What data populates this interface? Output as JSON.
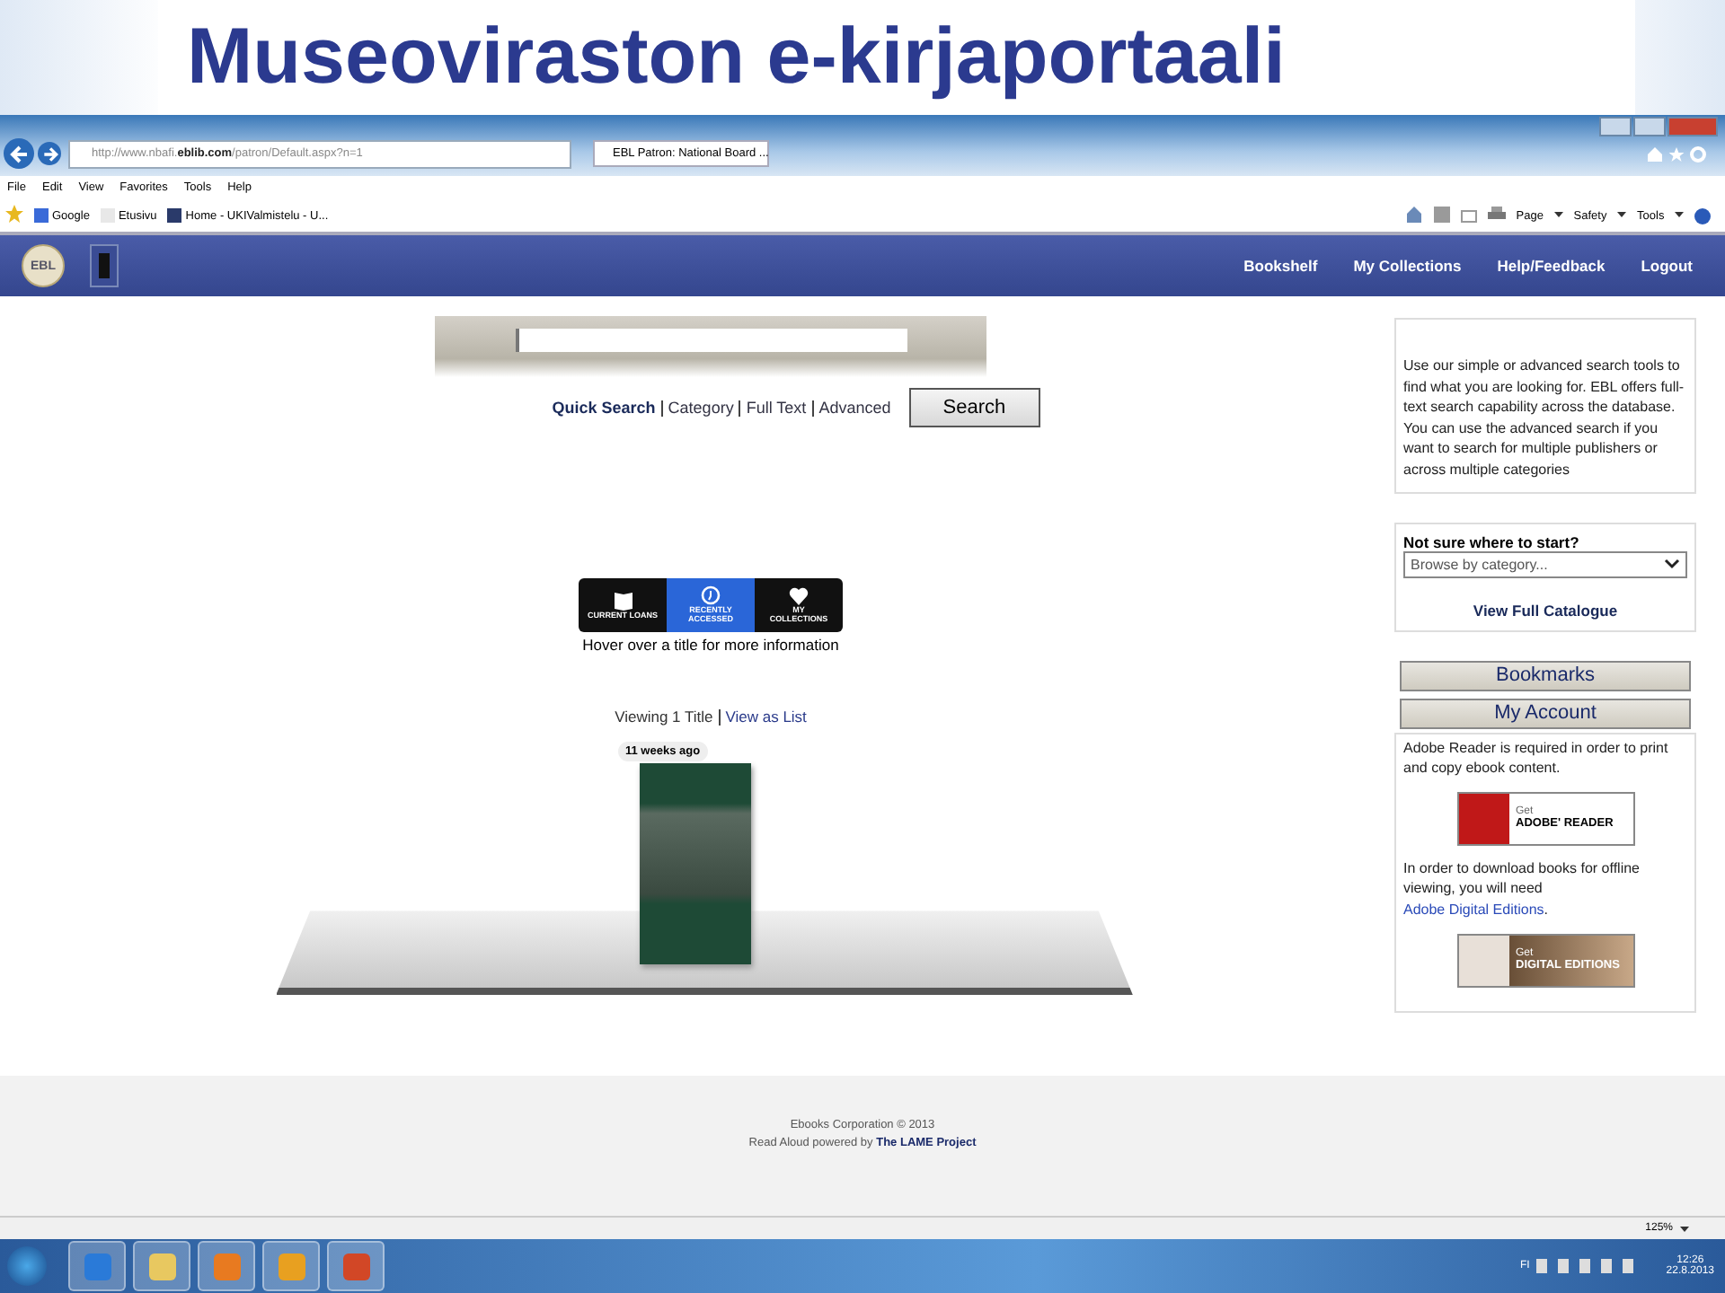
{
  "slide_title": "Museoviraston e-kirjaportaali",
  "browser": {
    "address": "http://www.nbafi.**eblib.com**/patron/Default.aspx?n=1",
    "tab_title": "EBL Patron: National Board ...",
    "menu": [
      "File",
      "Edit",
      "View",
      "Favorites",
      "Tools",
      "Help"
    ],
    "favorites": [
      {
        "kind": "google",
        "label": "Google"
      },
      {
        "kind": "page",
        "label": "Etusivu"
      },
      {
        "kind": "site",
        "label": "Home - UKIValmistelu - U..."
      }
    ],
    "command_bar": [
      "Page",
      "Safety",
      "Tools"
    ],
    "zoom": "125%"
  },
  "site": {
    "logo": "EBL",
    "nav": [
      "Bookshelf",
      "My Collections",
      "Help/Feedback",
      "Logout"
    ],
    "search": {
      "modes": [
        {
          "label": "Quick Search",
          "selected": true
        },
        {
          "label": "Category",
          "selected": false
        },
        {
          "label": "Full Text",
          "selected": false
        },
        {
          "label": "Advanced",
          "selected": false
        }
      ],
      "button": "Search"
    },
    "shelf_tabs": [
      {
        "kind": "book",
        "label": "CURRENT LOANS",
        "selected": false
      },
      {
        "kind": "clock",
        "label": "RECENTLY ACCESSED",
        "selected": true
      },
      {
        "kind": "heart",
        "label": "MY COLLECTIONS",
        "selected": false
      }
    ],
    "hint": "Hover over a title for more information",
    "viewing": "Viewing 1 Title",
    "view_as_list": "View as List",
    "book_badge": "11 weeks ago",
    "sidebar": {
      "info": "Use our simple or advanced search tools to find what you are looking for. EBL offers full-text search capability across the database. You can use the advanced search if you want to search for multiple publishers or across multiple categories",
      "browse_heading": "Not sure where to start?",
      "browse_placeholder": "Browse by category...",
      "catalogue_link": "View Full Catalogue",
      "buttons": [
        "Bookmarks",
        "My Account"
      ],
      "adobe_text": "Adobe Reader is required in order to print and copy ebook content.",
      "reader_badge": {
        "small": "Get",
        "big": "ADOBE' READER"
      },
      "offline_text": "In order to download books for offline viewing, you will need",
      "offline_link": "Adobe Digital Editions",
      "offline_tail": ".",
      "editions_badge": {
        "small": "Get",
        "big": "DIGITAL EDITIONS"
      }
    },
    "footer": {
      "copyright": "Ebooks Corporation © 2013",
      "read_aloud": "Read Aloud powered by",
      "lame_link": "The LAME Project"
    }
  },
  "taskbar": {
    "apps": [
      {
        "kind": "ie"
      },
      {
        "kind": "folder"
      },
      {
        "kind": "media"
      },
      {
        "kind": "outlook"
      },
      {
        "kind": "powerpoint"
      }
    ],
    "language": "FI",
    "time": "12:26",
    "date": "22.8.2013"
  }
}
